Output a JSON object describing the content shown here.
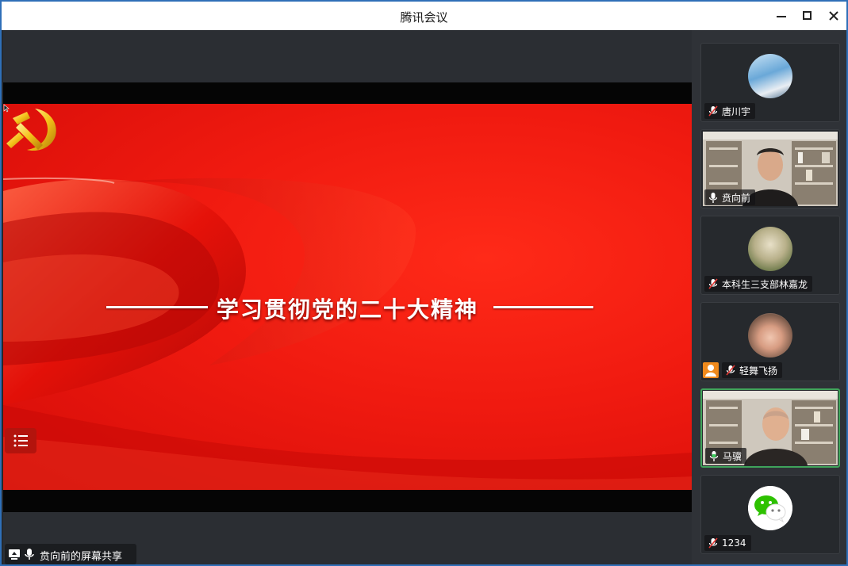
{
  "window": {
    "title": "腾讯会议"
  },
  "slide": {
    "title": "学习贯彻党的二十大精神"
  },
  "share_bar": {
    "label": "贲向前的屏幕共享"
  },
  "participants": [
    {
      "name": "唐川宇",
      "mic": "muted",
      "view": "avatar"
    },
    {
      "name": "贲向前",
      "mic": "on",
      "view": "video"
    },
    {
      "name": "本科生三支部林嘉龙",
      "mic": "muted",
      "view": "avatar"
    },
    {
      "name": "轻舞飞扬",
      "mic": "muted",
      "view": "avatar",
      "host": true
    },
    {
      "name": "马骥",
      "mic": "speaking",
      "view": "video",
      "active": true
    },
    {
      "name": "1234",
      "mic": "muted",
      "view": "avatar"
    }
  ],
  "colors": {
    "slide_red": "#f01a10",
    "active_border": "#3fa35a",
    "host_badge": "#f08a1c",
    "window_border": "#2f6fb8"
  },
  "icons": [
    "minimize-icon",
    "maximize-icon",
    "close-icon",
    "list-icon",
    "share-screen-icon",
    "mic-icon",
    "mic-muted-icon",
    "host-icon",
    "wechat-icon"
  ]
}
